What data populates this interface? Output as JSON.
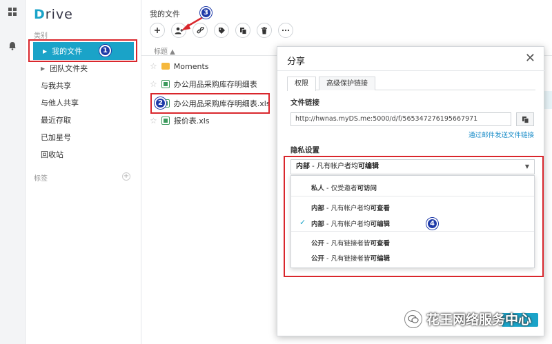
{
  "sidebar": {
    "logo": {
      "d": "D",
      "rest": "rive"
    },
    "section_category": "类别",
    "items": [
      {
        "label": "我的文件",
        "active": true,
        "caret": "▶"
      },
      {
        "label": "团队文件夹",
        "caret": "▶"
      },
      {
        "label": "与我共享"
      },
      {
        "label": "与他人共享"
      },
      {
        "label": "最近存取"
      },
      {
        "label": "已加星号"
      },
      {
        "label": "回收站"
      }
    ],
    "section_tags": "标签",
    "tags_add": "+"
  },
  "main": {
    "breadcrumb": "我的文件",
    "column_header": "标题 ▲",
    "files": [
      {
        "name": "Moments",
        "type": "folder"
      },
      {
        "name": "办公用品采购库存明细表",
        "type": "xls"
      },
      {
        "name": "办公用品采购库存明细表.xls",
        "type": "xls"
      },
      {
        "name": "报价表.xls",
        "type": "xls"
      }
    ]
  },
  "annotations": [
    "1",
    "2",
    "3",
    "4"
  ],
  "dialog": {
    "title": "分享",
    "close": "✕",
    "tabs": [
      "权限",
      "高级保护链接"
    ],
    "file_link_label": "文件链接",
    "file_link": "http://hwnas.myDS.me:5000/d/f/565347276195667971",
    "email_link": "通过邮件发送文件链接",
    "privacy_label": "隐私设置",
    "selected": {
      "prefix": "内部",
      "middle": " - 凡有帐户者均",
      "bold": "可编辑"
    },
    "options": [
      {
        "prefix": "私人",
        "middle": " - 仅受邀者",
        "bold": "可访问"
      },
      {
        "prefix": "内部",
        "middle": " - 凡有帐户者均",
        "bold": "可查看"
      },
      {
        "prefix": "内部",
        "middle": " - 凡有帐户者均",
        "bold": "可编辑"
      },
      {
        "prefix": "公开",
        "middle": " - 凡有链接者皆",
        "bold": "可查看"
      },
      {
        "prefix": "公开",
        "middle": " - 凡有链接者皆",
        "bold": "可编辑"
      }
    ],
    "check": "✓"
  },
  "watermark": "花王网络服务中心",
  "colors": {
    "accent": "#1aa3c8",
    "highlight": "#d9262c",
    "badge": "#1e3aa8"
  }
}
